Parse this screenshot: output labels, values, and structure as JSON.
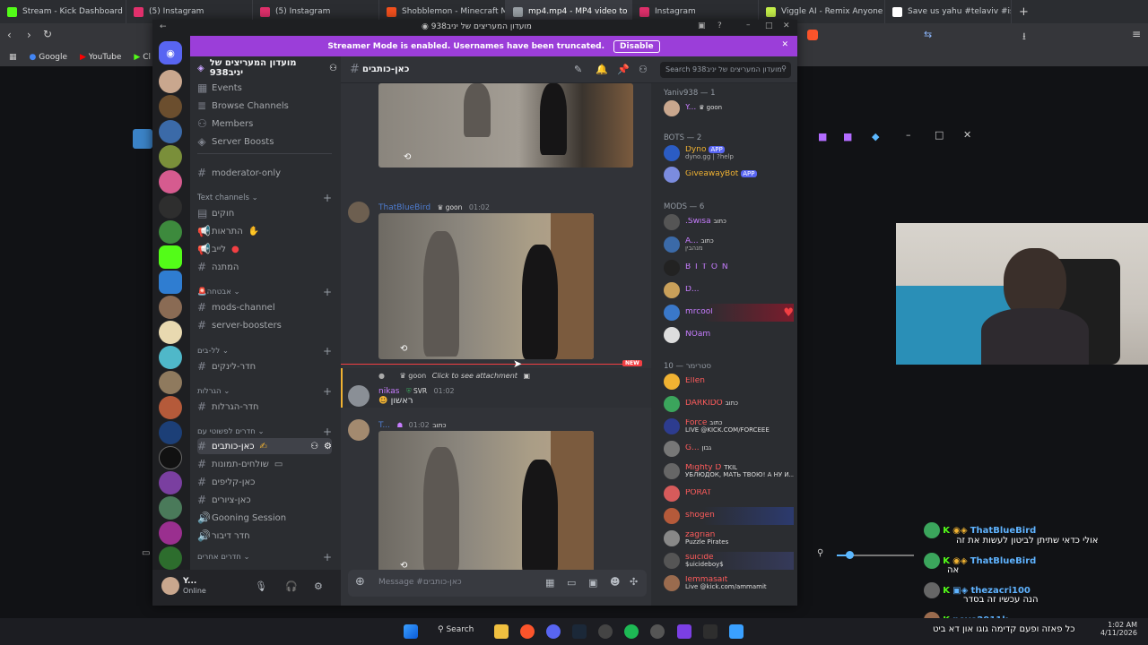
{
  "browser": {
    "tabs": [
      {
        "label": "Stream - Kick Dashboard",
        "color": "#53fc18"
      },
      {
        "label": "(5) Instagram",
        "color": "#e1306c"
      },
      {
        "label": "(5) Instagram",
        "color": "#e1306c"
      },
      {
        "label": "Shobblemon - Minecraft Mod",
        "color": "#f4511e"
      },
      {
        "label": "mp4.mp4 - MP4 video to",
        "color": "#9aa0a6"
      },
      {
        "label": "Instagram",
        "color": "#e1306c"
      },
      {
        "label": "Viggle AI - Remix Anyone into",
        "color": "#c6f14a"
      },
      {
        "label": "Save us yahu #telaviv #israel",
        "color": "#ffffff"
      }
    ],
    "new_tab_glyph": "+",
    "bookmarks": [
      "Google",
      "YouTube",
      "Cl"
    ]
  },
  "discord": {
    "window_title": "מועדון המעריצים של יניב938",
    "banner_text": "Streamer Mode is enabled. Usernames have been truncated.",
    "banner_button": "Disable",
    "server_name": "מועדון המעריצים של יניב938",
    "top_items": [
      "Events",
      "Browse Channels",
      "Members",
      "Server Boosts"
    ],
    "channels_a": [
      "moderator-only"
    ],
    "cat_text": "Text channels",
    "channels_b": [
      "חוקים",
      "התראות",
      "לייב",
      "המתנה"
    ],
    "cat_abuse": "אבטחה",
    "channels_c": [
      "mods-channel",
      "server-boosters"
    ],
    "cat_levels": "לל-בים",
    "channels_d": [
      "חדר-לינקים"
    ],
    "cat_gargalot": "הגרלות",
    "channels_e": [
      "חדר-הגרלות"
    ],
    "cat_general": "חדרים לפשוטי עם",
    "channels_f": [
      "כאן-כותבים",
      "שולחים-תמונות",
      "כאן-קליפים",
      "כאן-ציורים",
      "Gooning Session",
      "חדר דיבור"
    ],
    "cat_other": "חדרים אחרים",
    "current_channel": "כאן-כותבים",
    "search_placeholder": "Search מועדון המעריצים של יניב938",
    "user": {
      "name": "Y...",
      "status": "Online"
    },
    "messages": [
      {
        "author": "ThatBlueBird",
        "badge": "goon",
        "time": "01:02"
      },
      {
        "reply_badge": "goon",
        "reply_text": "Click to see attachment",
        "new_label": "NEW"
      },
      {
        "author": "nikas",
        "badge": "SVR",
        "time": "01:02",
        "text": "ראשון"
      },
      {
        "author": "T...",
        "badge": "כתוב",
        "time": "01:02"
      }
    ],
    "composer_placeholder": "Message #כאן-כותבים",
    "members": {
      "cat_owner": "Yaniv938 — 1",
      "owner": {
        "name": "Y...",
        "tag": "goon"
      },
      "cat_bots": "BOTS — 2",
      "bots": [
        {
          "name": "Dyno",
          "tag": "APP",
          "sub": "dyno.gg | ?help",
          "color": "#f0b232"
        },
        {
          "name": "GiveawayBot",
          "tag": "APP",
          "sub": "",
          "color": "#f0b232"
        }
      ],
      "cat_mods": "MODS — 6",
      "mods": [
        {
          "name": ".Swisa",
          "tag": "כתוב",
          "sub": "",
          "color": "#c77dff"
        },
        {
          "name": "A...",
          "tag": "כתוב",
          "sub": "מנהבין",
          "color": "#c77dff"
        },
        {
          "name": "B I T O N",
          "tag": "",
          "sub": "",
          "color": "#c77dff"
        },
        {
          "name": "D...",
          "tag": "",
          "sub": "",
          "color": "#c77dff"
        },
        {
          "name": "mrcool",
          "tag": "",
          "sub": "",
          "color": "#c77dff"
        },
        {
          "name": "NOam",
          "tag": "",
          "sub": "",
          "color": "#c77dff"
        }
      ],
      "cat_sponsors": "סטרימר — 10",
      "sponsors": [
        {
          "name": "Ellen",
          "tag": "",
          "sub": "",
          "color": "#ff5c5c"
        },
        {
          "name": "DARKIDO",
          "tag": "כתוב",
          "sub": "",
          "color": "#ff5c5c"
        },
        {
          "name": "Force",
          "tag": "כתוב",
          "sub": "LIVE @KICK.COM/FORCEEE",
          "color": "#ff5c5c"
        },
        {
          "name": "G...",
          "tag": "גבון",
          "sub": "",
          "color": "#ff5c5c"
        },
        {
          "name": "Mighty D",
          "tag": "TKIL",
          "sub": "УБЛЮДОК, МАТЬ ТВОЮ! А НУ И...",
          "color": "#ff5c5c"
        },
        {
          "name": "PORAT",
          "tag": "",
          "sub": "",
          "color": "#ff5c5c"
        },
        {
          "name": "shogen",
          "tag": "",
          "sub": "",
          "color": "#ff5c5c"
        },
        {
          "name": "zagrian",
          "tag": "",
          "sub": "Puzzle Pirates",
          "color": "#ff5c5c"
        },
        {
          "name": "suicide",
          "tag": "",
          "sub": "$uicideboy$",
          "color": "#ff5c5c"
        },
        {
          "name": "lemmasait",
          "tag": "",
          "sub": "Live @kick.com/ammamit",
          "color": "#ff5c5c"
        }
      ]
    }
  },
  "stream_chat": [
    {
      "user": "ThatBlueBird",
      "text": "אולי כדאי שתיתן לביטון לעשות את זה"
    },
    {
      "user": "ThatBlueBird",
      "text": "אה"
    },
    {
      "user": "thezacri100",
      "text": "הנה עכשיו זה בסדר"
    },
    {
      "user": "nevo2911k",
      "text": "כל פאזה ופעם קדימה גוגו און דא ביט"
    }
  ],
  "taskbar": {
    "search_label": "Search",
    "time": "1:02 AM",
    "date": "4/11/2026"
  }
}
